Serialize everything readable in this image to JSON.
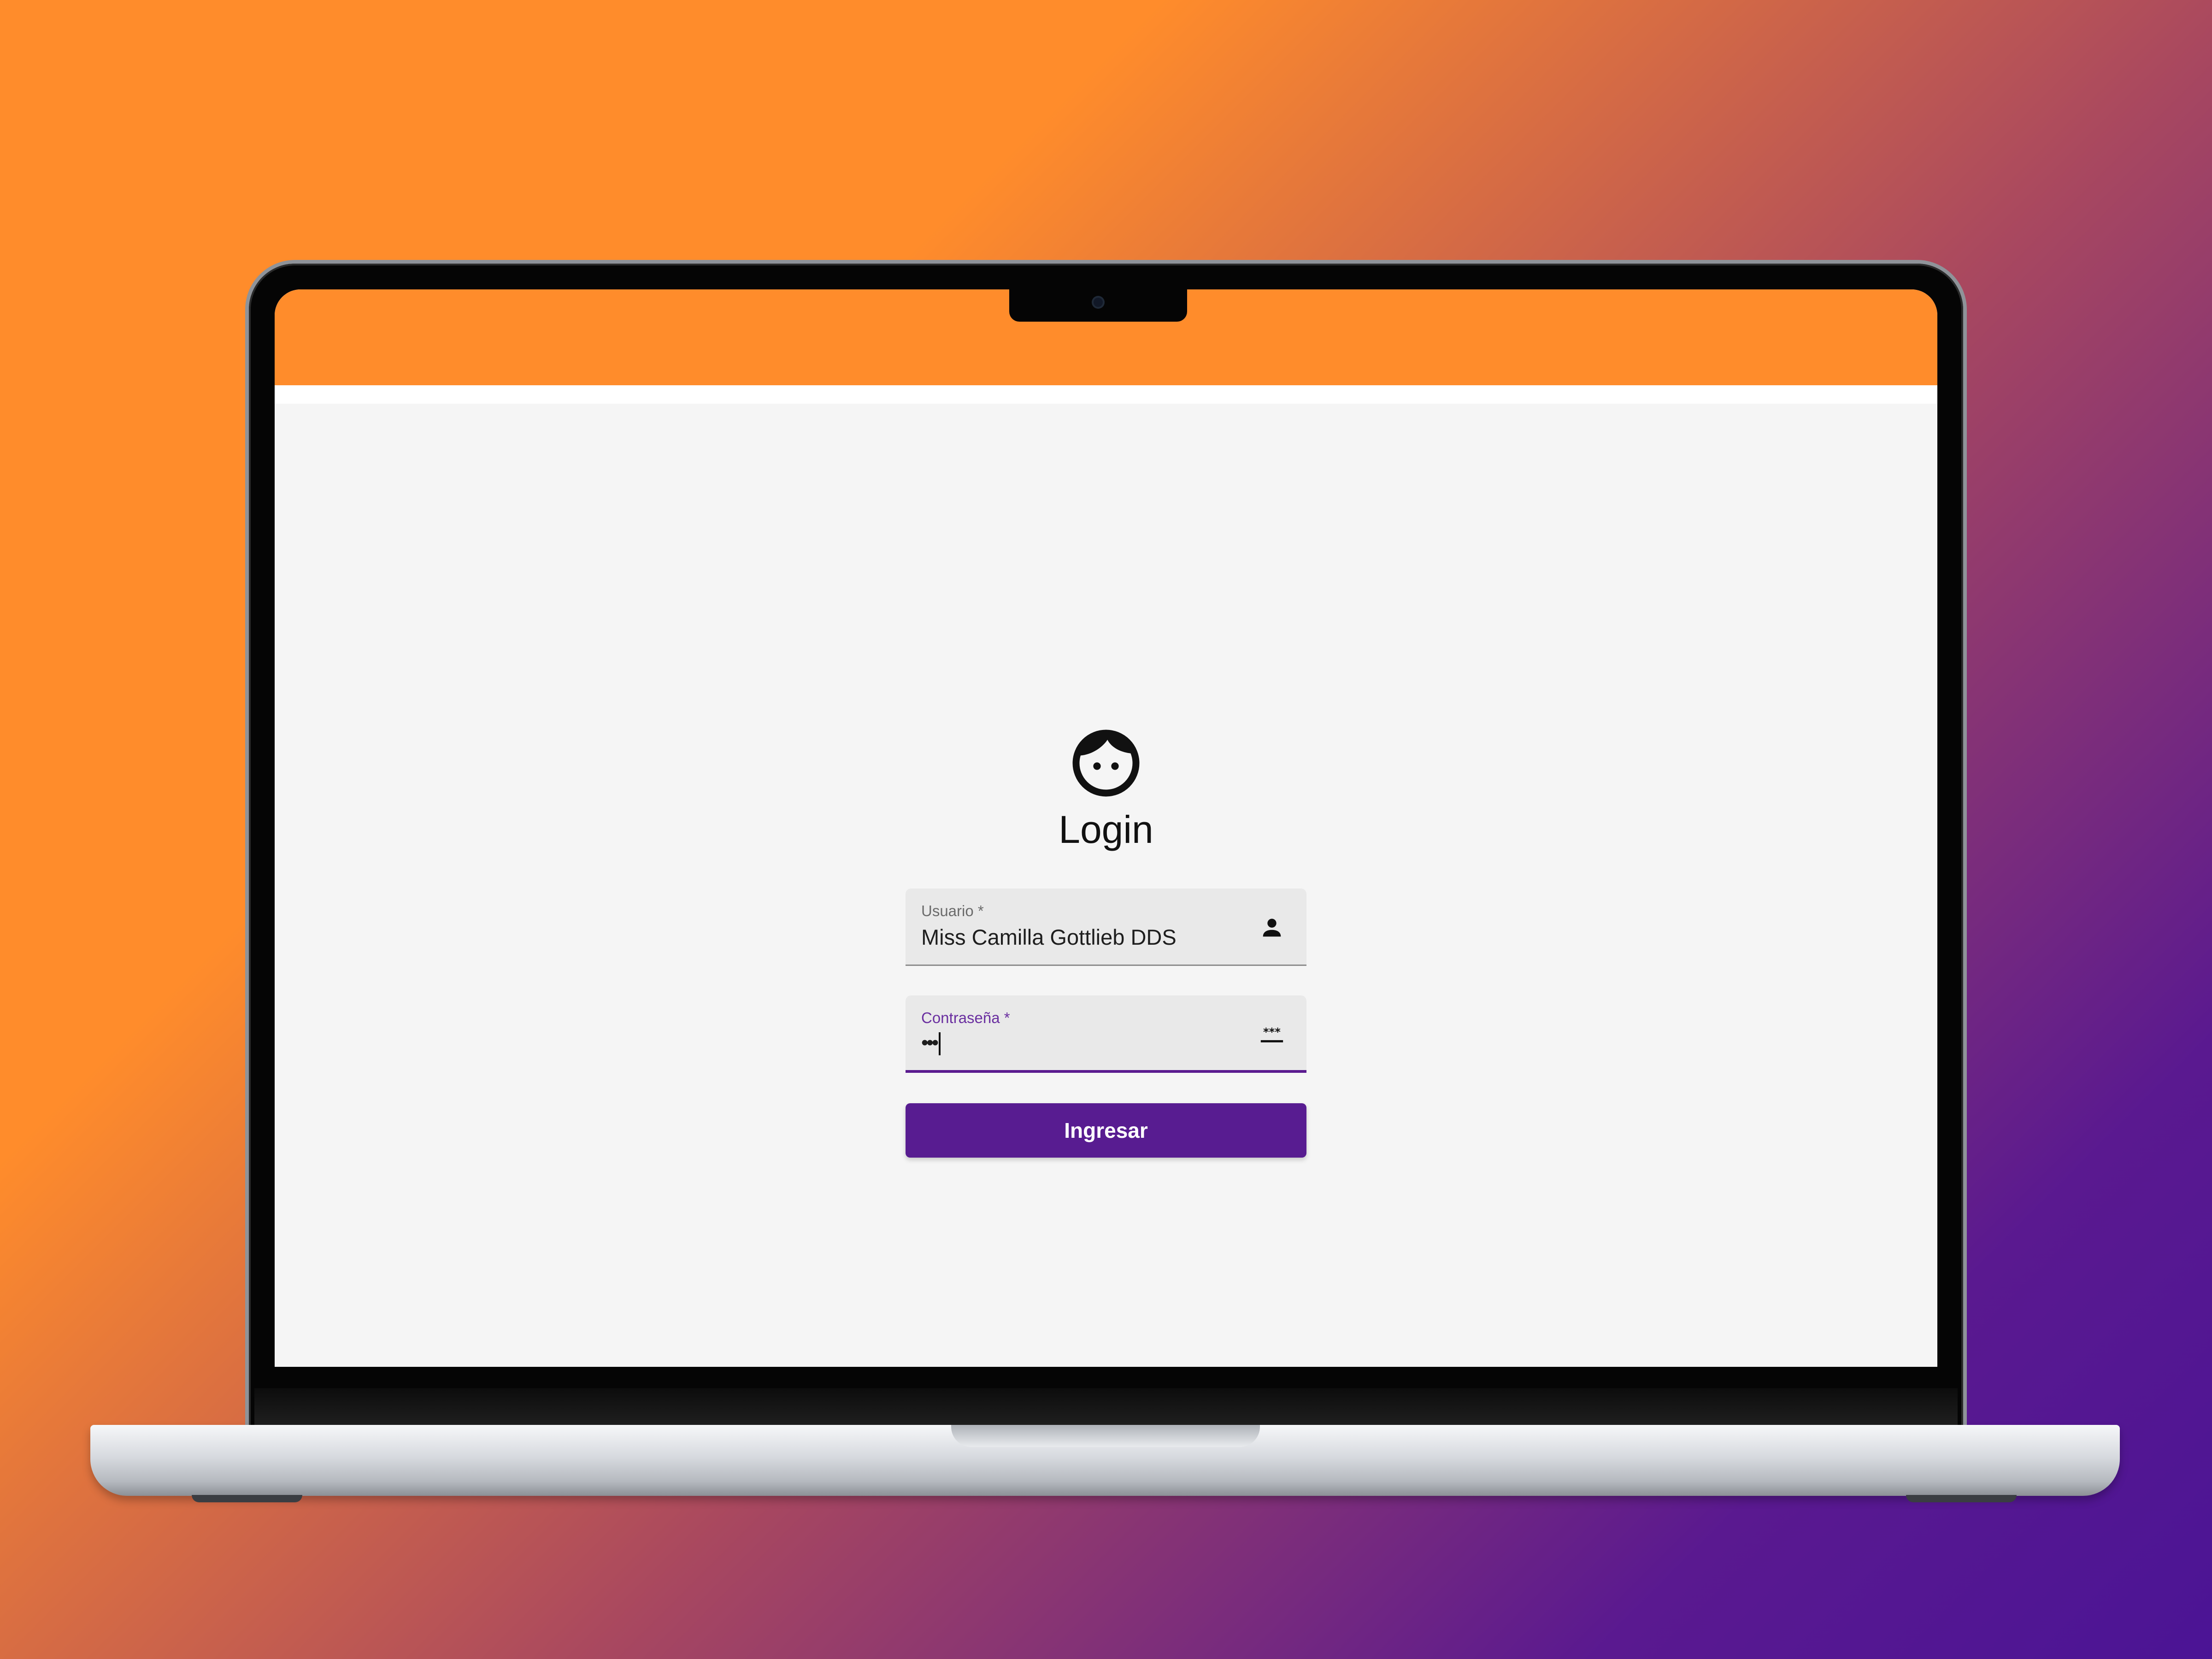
{
  "colors": {
    "toolbar": "#ff8c2b",
    "accent": "#581c91",
    "background": "#f5f5f5"
  },
  "login": {
    "title": "Login",
    "username": {
      "label": "Usuario *",
      "value": "Miss Camilla Gottlieb DDS",
      "icon": "person-icon"
    },
    "password": {
      "label": "Contraseña *",
      "masked_value": "•••",
      "icon": "password-dots-icon"
    },
    "submit_label": "Ingresar"
  }
}
